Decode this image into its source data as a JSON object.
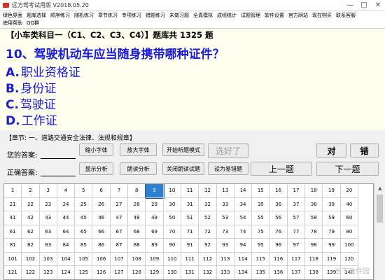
{
  "window": {
    "title": "远方驾考试用版 V2018.05.20",
    "minimize_label": "—",
    "maximize_label": "□",
    "close_label": "✕"
  },
  "menu": {
    "row1": [
      "绿色界面",
      "题库选择",
      "顺序练习",
      "随机练习",
      "章节练习",
      "专项练习",
      "错题练习",
      "未做习题",
      "全真模拟",
      "成绩统计",
      "试题管理",
      "软件设置",
      "官方网站",
      "现在购买",
      "联系客服"
    ],
    "row2": [
      "使用帮助",
      "QQ群"
    ]
  },
  "bank_header": "【小车类科目一（C1、C2、C3、C4）】题库共 1325 题",
  "question": {
    "text": "10、驾驶机动车应当随身携带哪种证件？",
    "options": [
      {
        "letter": "A.",
        "text": "职业资格证"
      },
      {
        "letter": "B.",
        "text": "身份证"
      },
      {
        "letter": "C.",
        "text": "驾驶证"
      },
      {
        "letter": "D.",
        "text": "工作证"
      }
    ]
  },
  "chapter": "【章节: 一、道路交通安全法律、法规和规章】",
  "answers": {
    "your_label": "您的答案:",
    "correct_label": "正确答案:"
  },
  "buttons": {
    "shrink_font": "缩小字体",
    "enlarge_font": "放大字体",
    "start_listen": "开始听题模式",
    "done": "选好了",
    "correct": "对",
    "wrong": "错",
    "show_analysis": "显示分析",
    "read_analysis": "朗读分析",
    "stop_reading": "关闭朗读试题",
    "set_easy_wrong": "设为易错题",
    "prev": "上一题",
    "next": "下一题"
  },
  "grid": {
    "numbers": [
      1,
      2,
      3,
      4,
      5,
      6,
      7,
      8,
      9,
      10,
      11,
      12,
      13,
      14,
      15,
      16,
      17,
      18,
      19,
      20,
      21,
      22,
      23,
      24,
      25,
      26,
      27,
      28,
      29,
      30,
      31,
      32,
      33,
      34,
      35,
      36,
      37,
      38,
      39,
      40,
      41,
      42,
      43,
      44,
      45,
      46,
      47,
      48,
      49,
      50,
      51,
      52,
      53,
      54,
      55,
      56,
      57,
      58,
      59,
      60,
      61,
      62,
      63,
      64,
      65,
      66,
      67,
      68,
      69,
      70,
      71,
      72,
      73,
      74,
      75,
      76,
      77,
      78,
      79,
      80,
      81,
      82,
      83,
      84,
      85,
      86,
      87,
      88,
      89,
      90,
      91,
      92,
      93,
      94,
      95,
      96,
      97,
      98,
      99,
      100,
      101,
      102,
      103,
      104,
      105,
      106,
      107,
      108,
      109,
      110,
      111,
      112,
      113,
      114,
      115,
      116,
      117,
      118,
      119,
      120,
      121,
      122,
      123,
      124,
      125,
      126,
      127,
      128,
      129,
      130,
      131,
      132,
      133,
      134,
      135,
      136,
      137,
      138,
      139,
      140
    ],
    "current": 9,
    "highlight_color": "#2f7fd0"
  },
  "watermark": "当下软件园",
  "colors": {
    "question_text": "#1a1adc",
    "panel_bg": "#fffff0"
  }
}
